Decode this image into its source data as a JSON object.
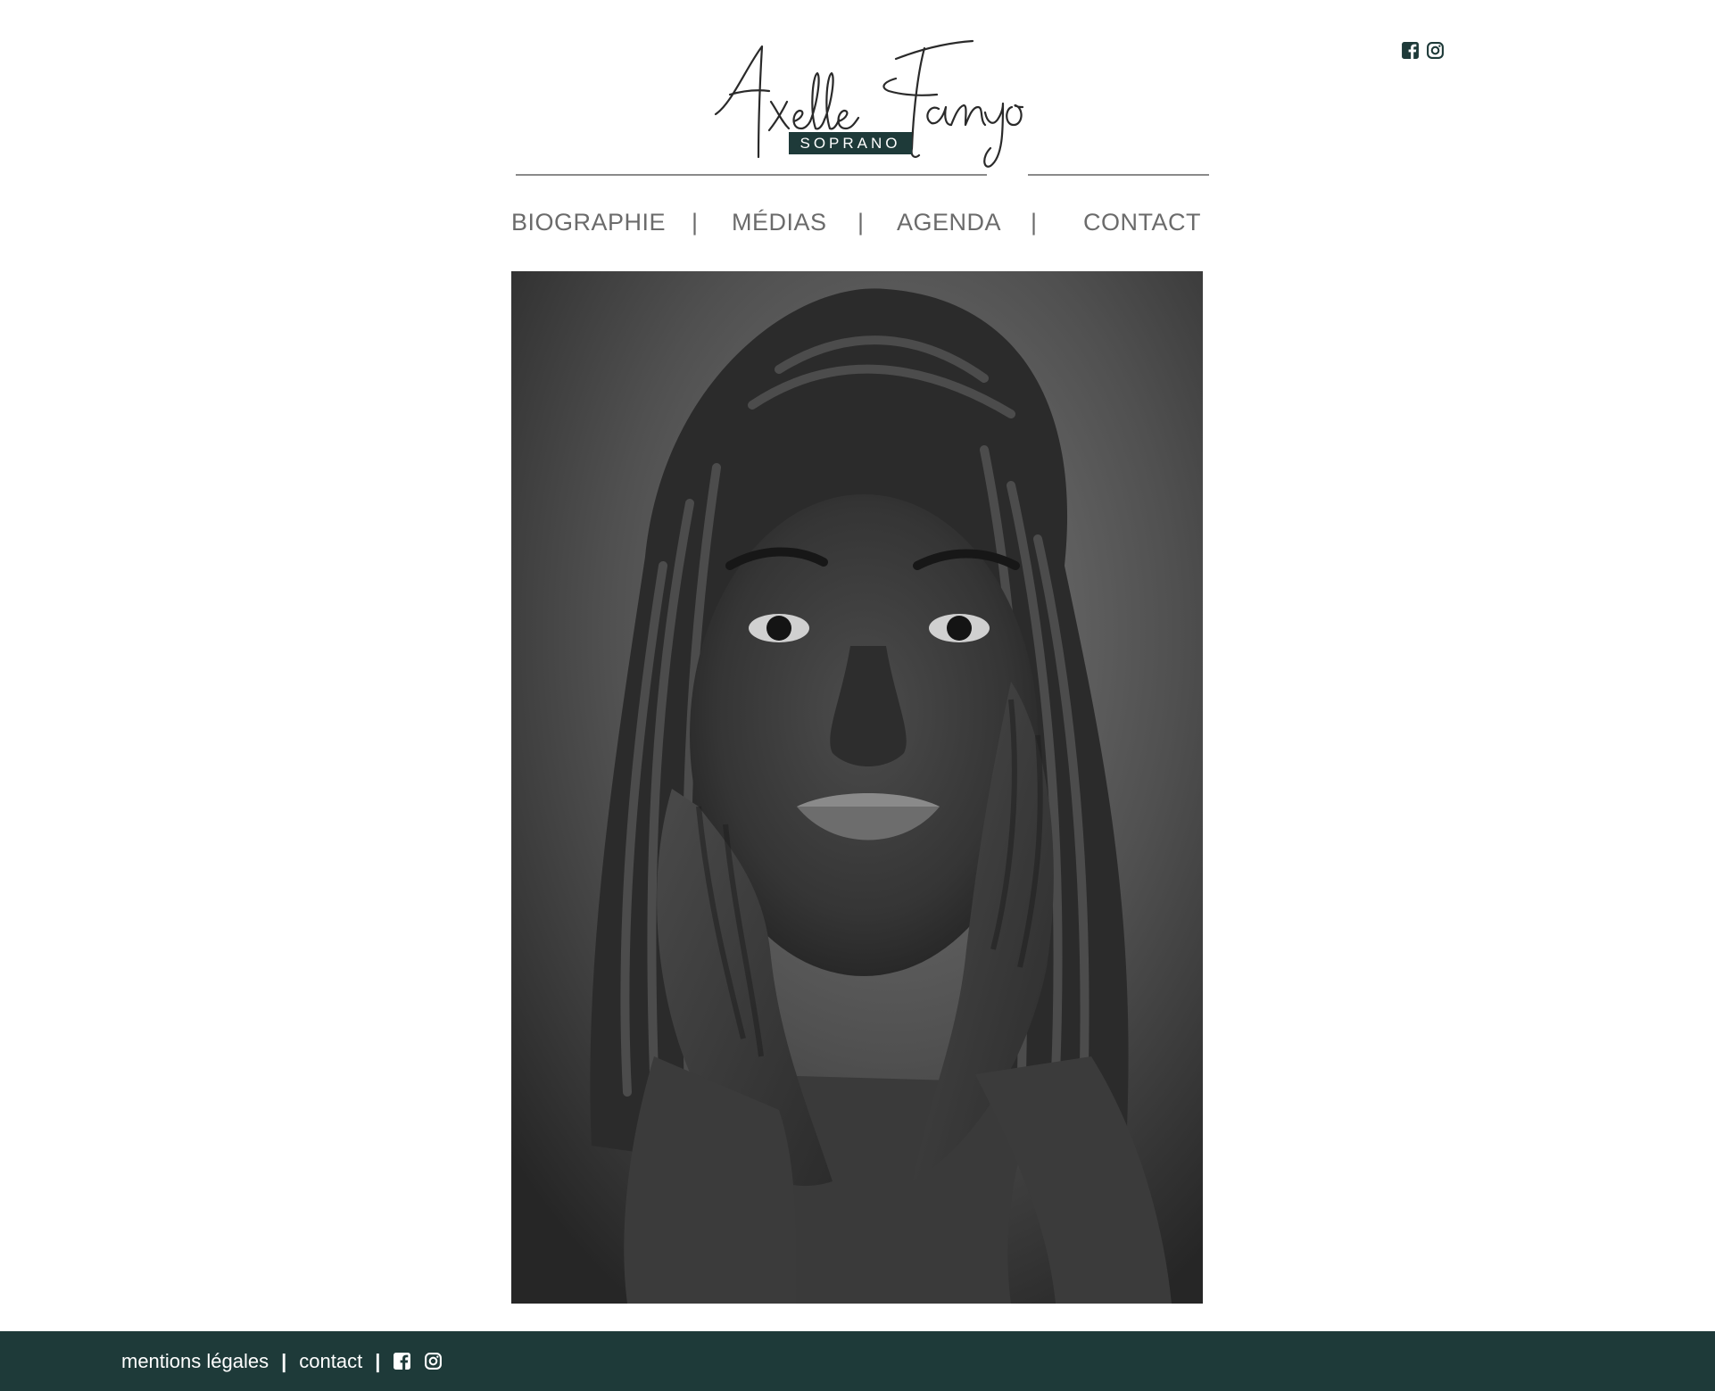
{
  "header": {
    "logo": {
      "script_name": "Axelle Fanyo",
      "tag": "SOPRANO",
      "tag_color": "#1e3a39"
    },
    "social": [
      {
        "icon": "facebook-icon"
      },
      {
        "icon": "instagram-icon"
      }
    ]
  },
  "nav": {
    "items": [
      "BIOGRAPHIE",
      "MÉDIAS",
      "AGENDA",
      "CONTACT"
    ],
    "separator": "|"
  },
  "hero": {
    "image": "black-and-white portrait"
  },
  "footer": {
    "legal": "mentions légales",
    "contact": "contact",
    "separator": "|",
    "background": "#1e3a39",
    "social": [
      {
        "icon": "facebook-icon"
      },
      {
        "icon": "instagram-icon"
      }
    ]
  }
}
